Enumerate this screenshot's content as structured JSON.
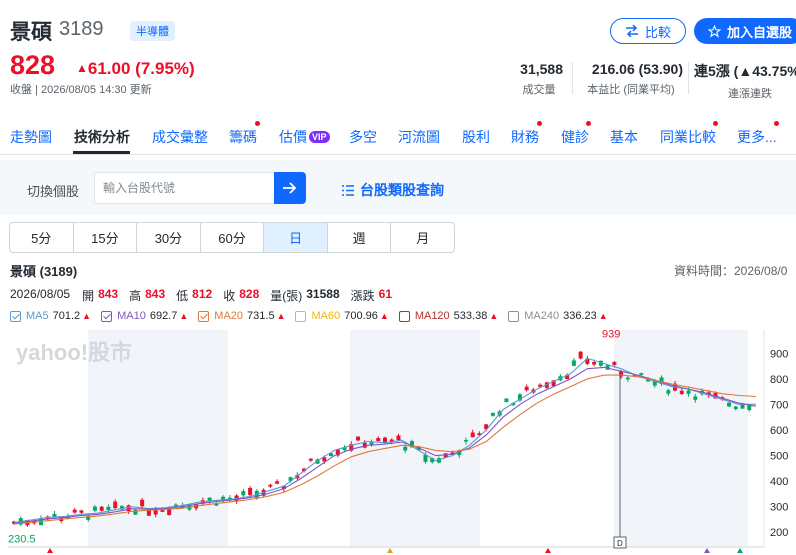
{
  "header": {
    "name": "景碩",
    "code": "3189",
    "industry": "半導體",
    "compare_label": "比較",
    "watchlist_label": "加入自選股",
    "price": "828",
    "change": "61.00 (7.95%)",
    "status_line": "收盤 | 2026/08/05 14:30 更新",
    "stats": [
      {
        "value": "31,588",
        "label": "成交量"
      },
      {
        "value": "216.06 (53.90)",
        "label": "本益比 (同業平均)"
      },
      {
        "value": "連5漲 (▲43.75%",
        "label": "連漲連跌"
      }
    ]
  },
  "nav": {
    "tabs": [
      "走勢圖",
      "技術分析",
      "成交彙整",
      "籌碼",
      "估價",
      "多空",
      "河流圖",
      "股利",
      "財務",
      "健診",
      "基本",
      "同業比較",
      "更多..."
    ],
    "vip_badge": "VIP"
  },
  "search": {
    "switch_label": "切換個股",
    "placeholder": "輸入台股代號",
    "category_link": "台股類股查詢"
  },
  "periods": [
    "5分",
    "15分",
    "30分",
    "60分",
    "日",
    "週",
    "月"
  ],
  "chart_header": {
    "title": "景碩 (3189)",
    "data_time": "資料時間：2026/08/0"
  },
  "ohlc": {
    "date": "2026/08/05",
    "open_label": "開",
    "open": "843",
    "high_label": "高",
    "high": "843",
    "low_label": "低",
    "low": "812",
    "close_label": "收",
    "close": "828",
    "volume_label": "量(張)",
    "volume": "31588",
    "change_label": "漲跌",
    "change": "61"
  },
  "ma": [
    {
      "name": "MA5",
      "value": "701.2",
      "color": "#5b9bd5",
      "checked": true
    },
    {
      "name": "MA10",
      "value": "692.7",
      "color": "#7e57c2",
      "checked": true
    },
    {
      "name": "MA20",
      "value": "731.5",
      "color": "#e0783a",
      "checked": true
    },
    {
      "name": "MA60",
      "value": "700.96",
      "color": "#f5b800",
      "checked": false
    },
    {
      "name": "MA120",
      "value": "533.38",
      "color": "#b5302c",
      "checked": false
    },
    {
      "name": "MA240",
      "value": "336.23",
      "color": "#8a8f94",
      "checked": false
    }
  ],
  "colors": {
    "up": "#eb0f29",
    "down": "#00ab5e",
    "accent": "#0f69ff"
  },
  "chart_data": {
    "type": "line",
    "title": "",
    "y_ticks": [
      200,
      300,
      400,
      500,
      600,
      700,
      800,
      900
    ],
    "ylim": [
      150,
      960
    ],
    "high_label": "939",
    "low_label": "230.5",
    "marker_label": "D",
    "watermark": "yahoo!股市",
    "series": [
      {
        "name": "MA5",
        "values": [
          238,
          248,
          258,
          262,
          270,
          275,
          288,
          300,
          292,
          296,
          305,
          318,
          325,
          330,
          340,
          360,
          380,
          430,
          480,
          520,
          540,
          555,
          550,
          560,
          520,
          480,
          500,
          540,
          600,
          680,
          720,
          760,
          790,
          820,
          880,
          860,
          840,
          810,
          790,
          770,
          760,
          740,
          720,
          700,
          701
        ]
      },
      {
        "name": "MA10",
        "values": [
          235,
          243,
          252,
          258,
          265,
          270,
          280,
          292,
          290,
          293,
          300,
          312,
          320,
          327,
          335,
          350,
          370,
          410,
          455,
          500,
          525,
          540,
          545,
          553,
          530,
          500,
          505,
          530,
          580,
          650,
          700,
          740,
          770,
          800,
          840,
          845,
          830,
          815,
          795,
          775,
          760,
          745,
          725,
          705,
          693
        ]
      },
      {
        "name": "MA20",
        "values": [
          232,
          238,
          245,
          252,
          258,
          264,
          272,
          282,
          286,
          289,
          294,
          304,
          312,
          320,
          328,
          340,
          356,
          385,
          420,
          460,
          495,
          515,
          528,
          540,
          535,
          520,
          515,
          525,
          555,
          610,
          660,
          705,
          740,
          770,
          800,
          815,
          815,
          808,
          795,
          780,
          768,
          755,
          742,
          735,
          731
        ]
      }
    ]
  }
}
